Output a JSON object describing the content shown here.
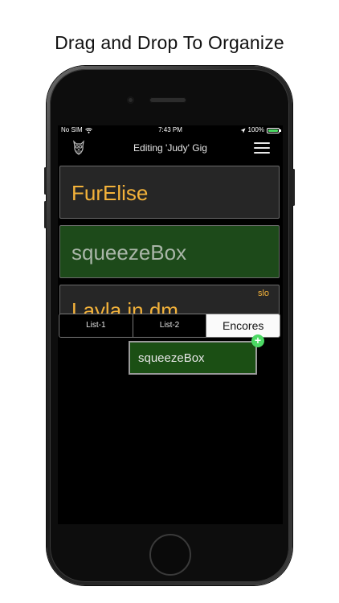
{
  "headline": "Drag and Drop To Organize",
  "status_bar": {
    "carrier": "No SIM",
    "wifi_icon": "wifi-icon",
    "time": "7:43 PM",
    "location_icon": "location-arrow-icon",
    "battery_percent": "100%",
    "battery_level": 1.0,
    "battery_color": "#4cd964"
  },
  "navbar": {
    "title": "Editing 'Judy' Gig",
    "logo_icon": "owl-logo-icon",
    "menu_icon": "hamburger-menu-icon"
  },
  "songs": [
    {
      "title": "FurElise",
      "tag": "",
      "highlighted": false
    },
    {
      "title": "squeezeBox",
      "tag": "",
      "highlighted": true
    },
    {
      "title": "Layla in dm",
      "tag": "slo",
      "highlighted": false
    }
  ],
  "tabs": [
    {
      "label": "List-1",
      "active": false
    },
    {
      "label": "List-2",
      "active": false
    },
    {
      "label": "Encores",
      "active": true
    }
  ],
  "drag_item": {
    "label": "squeezeBox",
    "add_icon": "plus-badge-icon",
    "add_symbol": "+"
  },
  "colors": {
    "accent_orange": "#f3b23a",
    "highlight_green": "#1d4a1a",
    "drag_green": "#1b4f14",
    "add_green": "#4cd964"
  }
}
